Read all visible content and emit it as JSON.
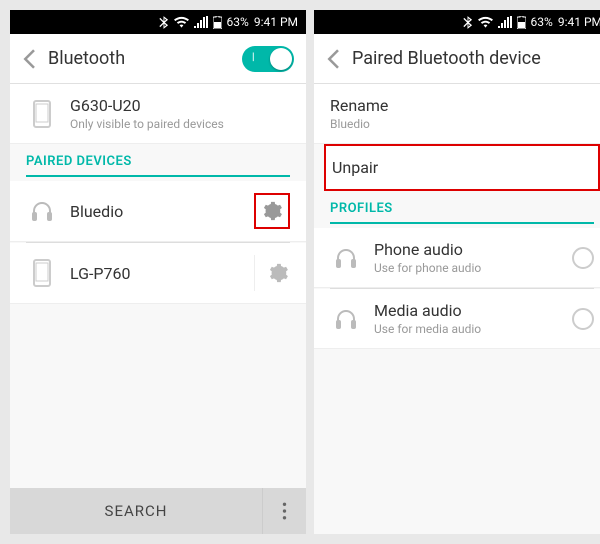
{
  "status": {
    "battery": "63%",
    "time": "9:41 PM"
  },
  "left": {
    "title": "Bluetooth",
    "toggle_on": true,
    "self": {
      "name": "G630-U20",
      "note": "Only visible to paired devices"
    },
    "section": "PAIRED DEVICES",
    "paired": [
      {
        "name": "Bluedio",
        "type": "headphones"
      },
      {
        "name": "LG-P760",
        "type": "phone"
      }
    ],
    "search": "SEARCH"
  },
  "right": {
    "title": "Paired Bluetooth device",
    "rename": {
      "label": "Rename",
      "value": "Bluedio"
    },
    "unpair": "Unpair",
    "profiles_section": "PROFILES",
    "profiles": [
      {
        "name": "Phone audio",
        "desc": "Use for phone audio"
      },
      {
        "name": "Media audio",
        "desc": "Use for media audio"
      }
    ]
  }
}
